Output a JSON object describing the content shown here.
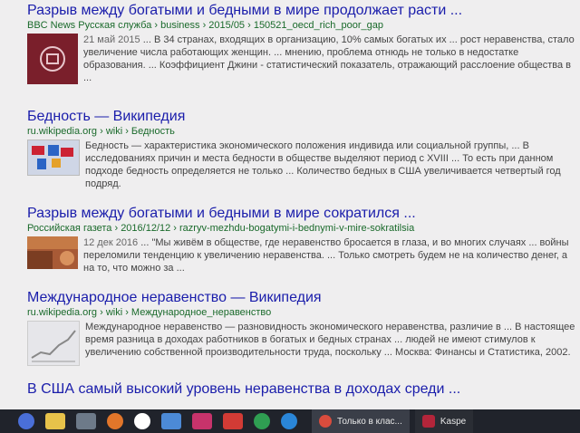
{
  "results": [
    {
      "title": "Разрыв между богатыми и бедными в мире продолжает расти ...",
      "cite": "BBC News Русская служба › business › 2015/05 › 150521_oecd_rich_poor_gap",
      "date": "21 май 2015",
      "snippet": "... В 34 странах, входящих в организацию, 10% самых богатых их ... рост неравенства, стало увеличение числа работающих женщин. ... мнению, проблема отнюдь не только в недостатке образования. ... Коэффициент Джини - статистический показатель, отражающий расслоение общества в ..."
    },
    {
      "title": "Бедность — Википедия",
      "cite": "ru.wikipedia.org › wiki › Бедность",
      "snippet": "Бедность — характеристика экономического положения индивида или социальной группы, ... В исследованиях причин и места бедности в обществе выделяют период с XVIII ... То есть при данном подходе бедность определяется не только ... Количество бедных в США увеличивается четвертый год подряд."
    },
    {
      "title": "Разрыв между богатыми и бедными в мире сократился ...",
      "cite": "Российская газета › 2016/12/12 › razryv-mezhdu-bogatymi-i-bednymi-v-mire-sokratilsia",
      "date": "12 дек 2016",
      "snippet": "... \"Мы живём в обществе, где неравенство бросается в глаза, и во многих случаях ... войны переломили тенденцию к увеличению неравенства. ... Только смотреть будем не на количество денег, а на то, что можно за ..."
    },
    {
      "title": "Международное неравенство — Википедия",
      "cite": "ru.wikipedia.org › wiki › Международное_неравенство",
      "snippet": "Международное неравенство — разновидность экономического неравенства, различие в ... В настоящее время разница в доходах работников в богатых и бедных странах ... людей не имеют стимулов к увеличению собственной производительности труда, поскольку ... Москва: Финансы и Статистика, 2002."
    },
    {
      "title": "В США самый высокий уровень неравенства в доходах среди ..."
    }
  ],
  "taskbar": {
    "active_label": "Только в клас...",
    "right_label": "Kaspe"
  }
}
